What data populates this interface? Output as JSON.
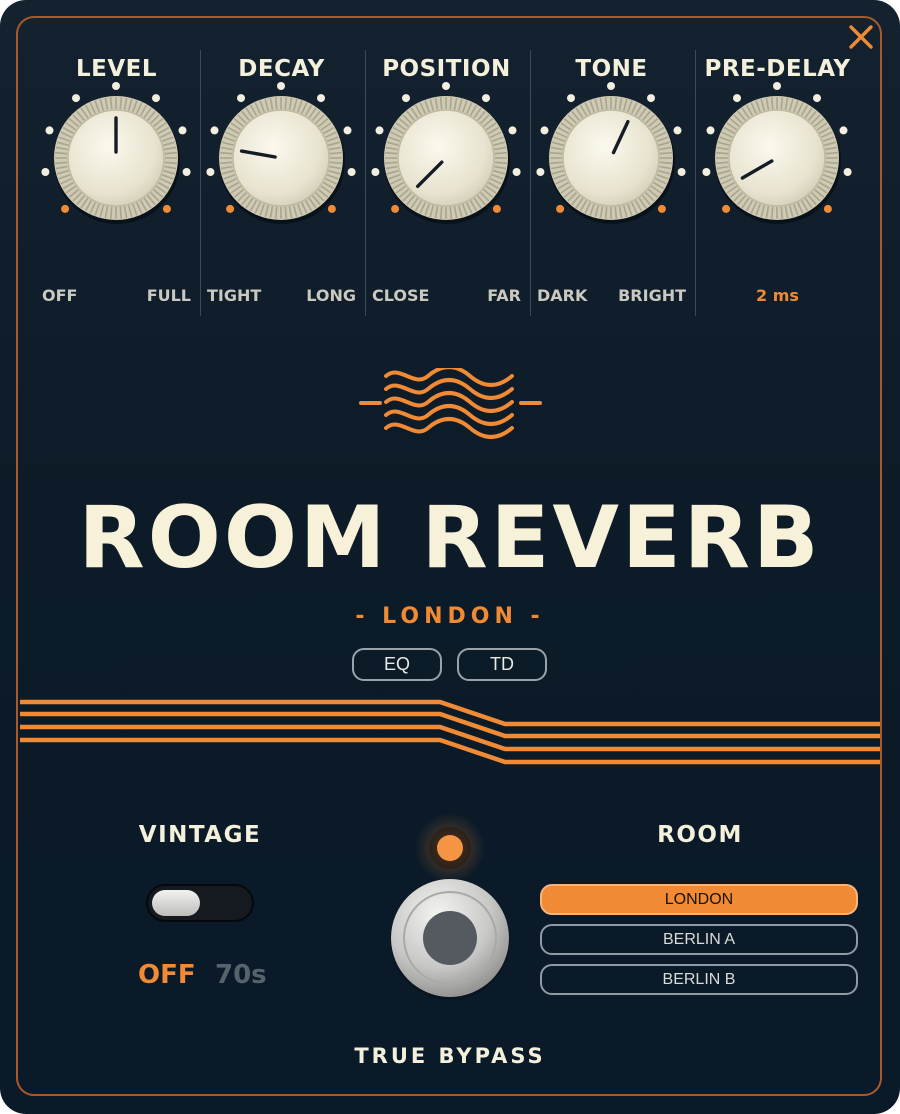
{
  "window": {
    "close_icon": "close-x-icon",
    "accent_color": "#f08a34"
  },
  "knobs": [
    {
      "id": "level",
      "title": "LEVEL",
      "left_label": "OFF",
      "right_label": "FULL",
      "angle": 0
    },
    {
      "id": "decay",
      "title": "DECAY",
      "left_label": "TIGHT",
      "right_label": "LONG",
      "angle": -80
    },
    {
      "id": "position",
      "title": "POSITION",
      "left_label": "CLOSE",
      "right_label": "FAR",
      "angle": -135
    },
    {
      "id": "tone",
      "title": "TONE",
      "left_label": "DARK",
      "right_label": "BRIGHT",
      "angle": 25
    },
    {
      "id": "predelay",
      "title": "PRE-DELAY",
      "value_label": "2 ms",
      "angle": -120
    }
  ],
  "logo_icon": "wave-logo-icon",
  "product": {
    "name": "ROOM REVERB",
    "subtitle": "- LONDON -"
  },
  "mode_buttons": [
    "EQ",
    "TD"
  ],
  "vintage": {
    "title": "VINTAGE",
    "off_label": "OFF",
    "on_label": "70s",
    "state": "OFF"
  },
  "bypass": {
    "led_on": true,
    "label": "TRUE BYPASS"
  },
  "room": {
    "title": "ROOM",
    "options": [
      "LONDON",
      "BERLIN A",
      "BERLIN B"
    ],
    "selected": "LONDON"
  }
}
